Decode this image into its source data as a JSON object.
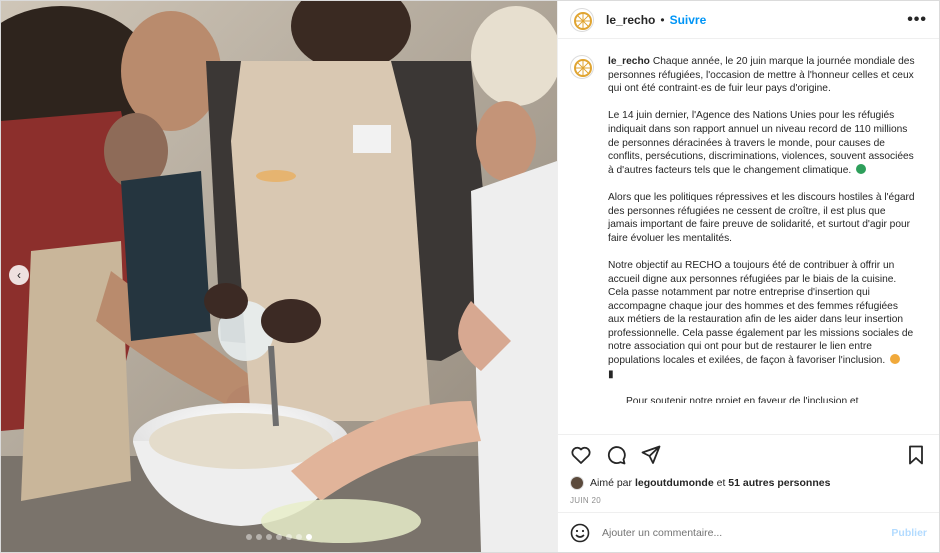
{
  "post": {
    "username": "le_recho",
    "separator": "•",
    "follow_label": "Suivre",
    "more_label": "•••",
    "photo_dots_total": 7,
    "photo_dots_active_index": 6
  },
  "caption": {
    "username": "le_recho",
    "paragraphs": [
      "Chaque année, le 20 juin marque la journée mondiale des personnes réfugiées, l'occasion de mettre à l'honneur celles et ceux qui ont été contraint·es de fuir leur pays d'origine.",
      "Le 14 juin dernier, l'Agence des Nations Unies pour les réfugiés indiquait dans son rapport annuel un niveau record de 110 millions de personnes déracinées à travers le monde, pour causes de conflits, persécutions, discriminations, violences, souvent associées à d'autres facteurs tels que le changement climatique.",
      "Alors que les politiques répressives et les discours hostiles à l'égard des personnes réfugiées ne cessent de croître, il est plus que jamais important de faire preuve de solidarité, et surtout d'agir pour faire évoluer les mentalités.",
      "Notre objectif au RECHO a toujours été de contribuer à offrir un accueil digne aux personnes réfugiées par le biais de la cuisine. Cela passe notamment par notre entreprise d'insertion qui accompagne chaque jour des hommes et des femmes réfugiées aux métiers de la restauration afin de les aider dans leur insertion professionnelle. Cela passe également par les missions sociales de notre association qui ont pour but de restaurer le lien entre populations locales et exilées, de façon à favoriser l'inclusion."
    ],
    "bullet_text": "Pour soutenir notre projet en faveur de l'inclusion et",
    "emoji_colors": {
      "globe": "#2e9f5b",
      "heart": "#f0a93b"
    }
  },
  "likes": {
    "prefix": "Aimé par",
    "user": "legoutdumonde",
    "conjunction": "et",
    "others": "51 autres personnes"
  },
  "date": "JUIN 20",
  "comment": {
    "placeholder": "Ajouter un commentaire...",
    "publish_label": "Publier"
  },
  "colors": {
    "link_blue": "#0095f6",
    "publish_disabled": "#b3dbff",
    "avatar_accent": "#e0a431"
  },
  "icons": [
    "heart-icon",
    "comment-icon",
    "share-icon",
    "bookmark-icon",
    "emoji-icon",
    "chevron-left-icon"
  ]
}
